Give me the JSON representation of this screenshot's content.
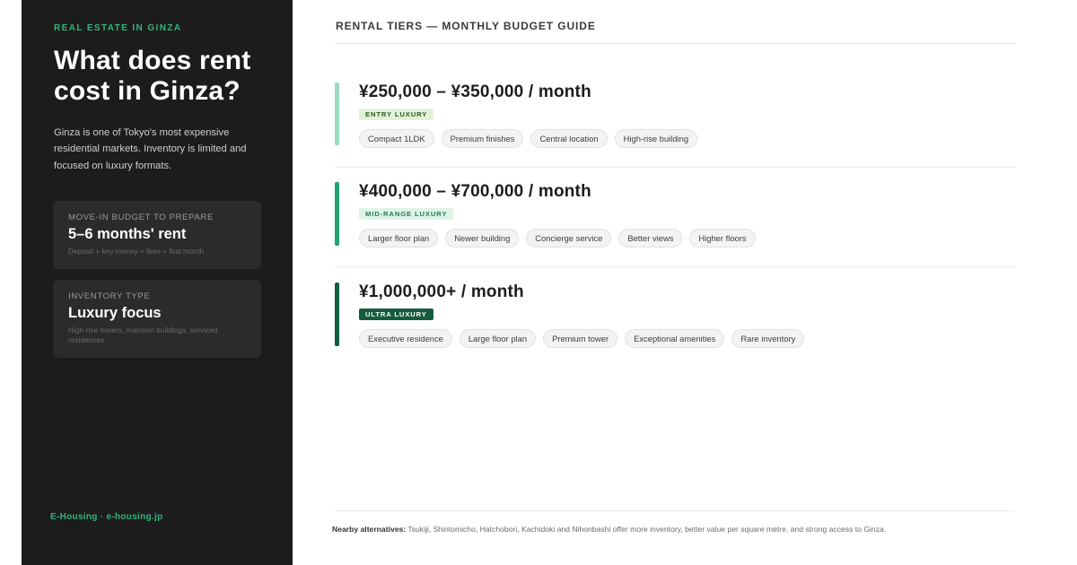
{
  "sidebar": {
    "eyebrow": "REAL ESTATE IN GINZA",
    "headline": "What does rent cost in Ginza?",
    "intro": "Ginza is one of Tokyo's most expensive residential markets. Inventory is limited and focused on luxury formats.",
    "cards": [
      {
        "label": "MOVE-IN BUDGET TO PREPARE",
        "value": "5–6 months' rent",
        "sub": "Deposit + key money + fees + first month"
      },
      {
        "label": "INVENTORY TYPE",
        "value": "Luxury focus",
        "sub": "High-rise towers, mansion buildings, serviced residences"
      }
    ],
    "footer": "E-Housing · e-housing.jp"
  },
  "main": {
    "heading": "RENTAL TIERS — MONTHLY BUDGET GUIDE",
    "tiers": [
      {
        "price": "¥250,000 – ¥350,000 / month",
        "badge": "ENTRY LUXURY",
        "bar_color": "#9bdcc0",
        "badge_bg": "#e2f2d8",
        "badge_fg": "#2f5a1f",
        "chips": [
          "Compact 1LDK",
          "Premium finishes",
          "Central location",
          "High-rise building"
        ]
      },
      {
        "price": "¥400,000 – ¥700,000 / month",
        "badge": "MID-RANGE LUXURY",
        "bar_color": "#23a26f",
        "badge_bg": "#dff3e8",
        "badge_fg": "#1f7a52",
        "chips": [
          "Larger floor plan",
          "Newer building",
          "Concierge service",
          "Better views",
          "Higher floors"
        ]
      },
      {
        "price": "¥1,000,000+ / month",
        "badge": "ULTRA LUXURY",
        "bar_color": "#0f5e3e",
        "badge_bg": "#155c3e",
        "badge_fg": "#ffffff",
        "chips": [
          "Executive residence",
          "Large floor plan",
          "Premium tower",
          "Exceptional amenities",
          "Rare inventory"
        ]
      }
    ],
    "footnote_label": "Nearby alternatives:",
    "footnote_text": " Tsukiji, Shintomicho, Hatchobori, Kachidoki and Nihonbashi offer more inventory, better value per square metre, and strong access to Ginza."
  }
}
